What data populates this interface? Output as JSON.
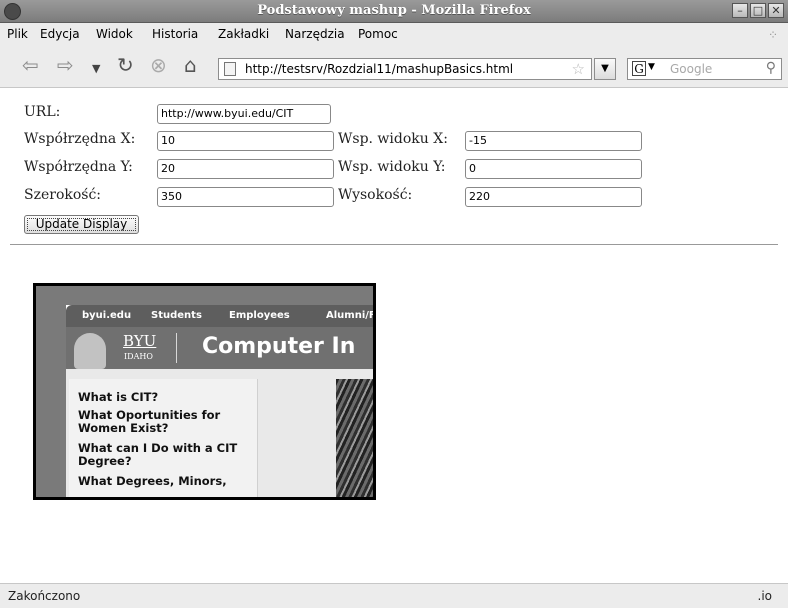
{
  "window": {
    "title": "Podstawowy mashup - Mozilla Firefox",
    "controls": [
      "–",
      "□",
      "✕"
    ]
  },
  "menu": [
    "Plik",
    "Edycja",
    "Widok",
    "Historia",
    "Zakładki",
    "Narzędzia",
    "Pomoc"
  ],
  "nav": {
    "back_icon": "back-arrow-icon",
    "forward_icon": "forward-arrow-icon",
    "url": "http://testsrv/Rozdzial11/mashupBasics.html",
    "search_placeholder": "Google",
    "search_engine": "G"
  },
  "form": {
    "url_label": "URL:",
    "url_value": "http://www.byui.edu/CIT",
    "x_label": "Współrzędna X:",
    "x_value": "10",
    "y_label": "Współrzędna Y:",
    "y_value": "20",
    "width_label": "Szerokość:",
    "width_value": "350",
    "vx_label": "Wsp. widoku X:",
    "vx_value": "-15",
    "vy_label": "Wsp. widoku Y:",
    "vy_value": "0",
    "height_label": "Wysokość:",
    "height_value": "220",
    "update_button": "Update Display"
  },
  "embedded_site": {
    "nav_items": [
      "byui.edu",
      "Students",
      "Employees",
      "Alumni/F"
    ],
    "brand": "BYU",
    "brand_sub": "IDAHO",
    "title": "Computer In",
    "sidebar": [
      "What is CIT?",
      "What Oportunities for Women Exist?",
      "What can I Do with a CIT Degree?",
      "What Degrees, Minors,"
    ]
  },
  "status": {
    "text": "Zakończono",
    "right": ".io"
  }
}
